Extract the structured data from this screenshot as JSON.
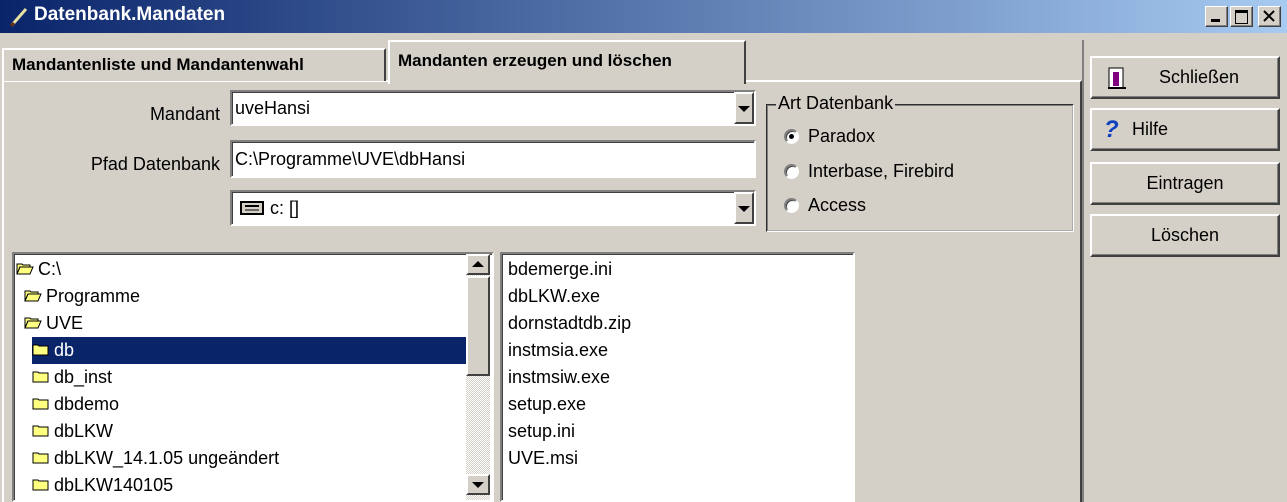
{
  "window": {
    "title": "Datenbank.Mandaten"
  },
  "tabs": [
    {
      "label": "Mandantenliste und  Mandantenwahl"
    },
    {
      "label": "Mandanten erzeugen und löschen"
    }
  ],
  "form": {
    "mandant_label": "Mandant",
    "mandant_value": "uveHansi",
    "pfad_label": "Pfad Datenbank",
    "pfad_value": "C:\\Programme\\UVE\\dbHansi",
    "drive_value": "c: []"
  },
  "db_type": {
    "legend": "Art Datenbank",
    "options": [
      "Paradox",
      "Interbase, Firebird",
      "Access"
    ],
    "selected": "Paradox"
  },
  "folders": [
    {
      "label": "C:\\",
      "icon": "open-folder-icon"
    },
    {
      "label": "Programme",
      "icon": "open-folder-icon"
    },
    {
      "label": "UVE",
      "icon": "open-folder-icon"
    },
    {
      "label": "db",
      "icon": "folder-icon",
      "selected": true
    },
    {
      "label": "db_inst",
      "icon": "folder-icon"
    },
    {
      "label": "dbdemo",
      "icon": "folder-icon"
    },
    {
      "label": "dbLKW",
      "icon": "folder-icon"
    },
    {
      "label": "dbLKW_14.1.05 ungeändert",
      "icon": "folder-icon"
    },
    {
      "label": "dbLKW140105",
      "icon": "folder-icon"
    }
  ],
  "files": [
    "bdemerge.ini",
    "dbLKW.exe",
    "dornstadtdb.zip",
    "instmsia.exe",
    "instmsiw.exe",
    "setup.exe",
    "setup.ini",
    "UVE.msi"
  ],
  "buttons": {
    "close": "Schließen",
    "help": "Hilfe",
    "add": "Eintragen",
    "delete": "Löschen"
  },
  "colors": {
    "titlebar_start": "#0a246a",
    "titlebar_end": "#a6caf0",
    "selection": "#0a246a",
    "face": "#d4d0c8"
  }
}
